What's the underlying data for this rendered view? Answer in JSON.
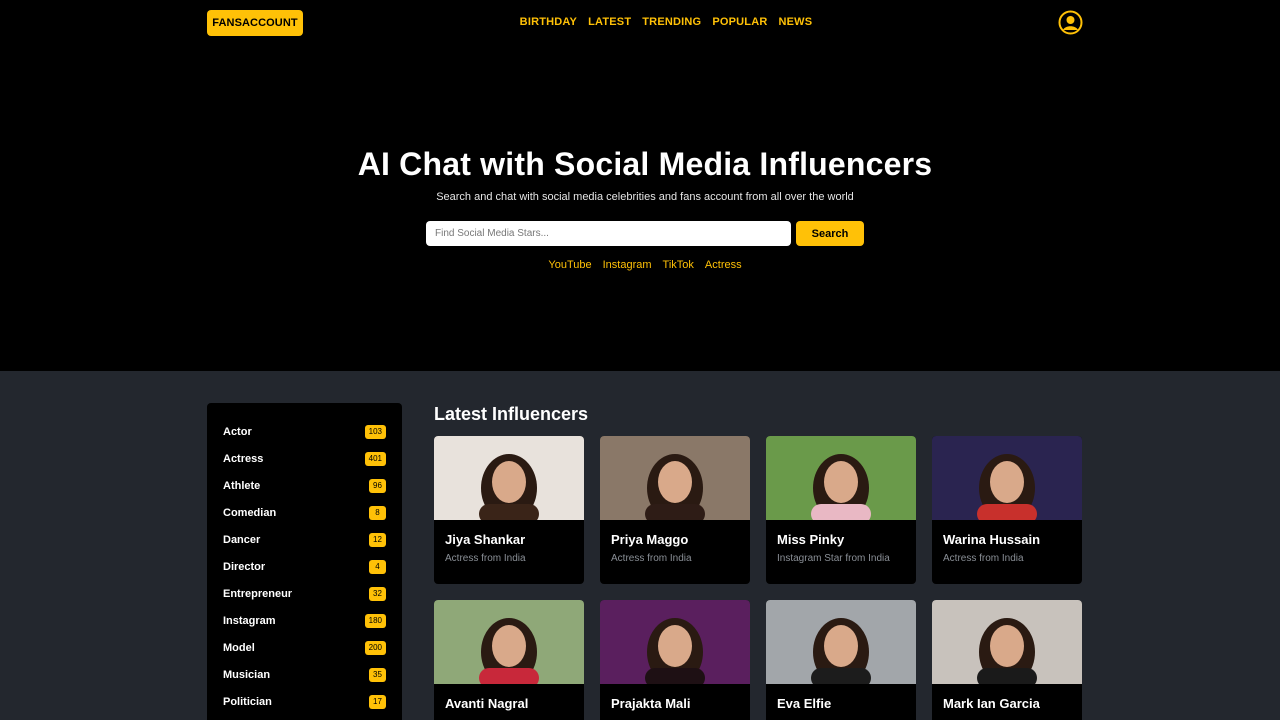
{
  "header": {
    "logo": "FANSACCOUNT",
    "nav": [
      "BIRTHDAY",
      "LATEST",
      "TRENDING",
      "POPULAR",
      "NEWS"
    ]
  },
  "hero": {
    "title": "AI Chat with Social Media Influencers",
    "subtitle": "Search and chat with social media celebrities and fans account from all over the world",
    "search_placeholder": "Find Social Media Stars...",
    "search_button": "Search",
    "quick_links": [
      "YouTube",
      "Instagram",
      "TikTok",
      "Actress"
    ]
  },
  "sidebar": {
    "categories": [
      {
        "label": "Actor",
        "count": "103"
      },
      {
        "label": "Actress",
        "count": "401"
      },
      {
        "label": "Athlete",
        "count": "96"
      },
      {
        "label": "Comedian",
        "count": "8"
      },
      {
        "label": "Dancer",
        "count": "12"
      },
      {
        "label": "Director",
        "count": "4"
      },
      {
        "label": "Entrepreneur",
        "count": "32"
      },
      {
        "label": "Instagram",
        "count": "180"
      },
      {
        "label": "Model",
        "count": "200"
      },
      {
        "label": "Musician",
        "count": "35"
      },
      {
        "label": "Politician",
        "count": "17"
      }
    ]
  },
  "main": {
    "section_title": "Latest Influencers",
    "cards": [
      {
        "name": "Jiya Shankar",
        "desc": "Actress from India",
        "bg": "#e8e2dc",
        "fg": "#3a2418"
      },
      {
        "name": "Priya Maggo",
        "desc": "Actress from India",
        "bg": "#8a7868",
        "fg": "#2e1c16"
      },
      {
        "name": "Miss Pinky",
        "desc": "Instagram Star from India",
        "bg": "#6a9a4a",
        "fg": "#e9b8c4"
      },
      {
        "name": "Warina Hussain",
        "desc": "Actress from India",
        "bg": "#2a2450",
        "fg": "#c8302c"
      },
      {
        "name": "Avanti Nagral",
        "desc": "",
        "bg": "#8fa878",
        "fg": "#c8283a"
      },
      {
        "name": "Prajakta Mali",
        "desc": "",
        "bg": "#5a1f5e",
        "fg": "#1e1014"
      },
      {
        "name": "Eva Elfie",
        "desc": "",
        "bg": "#a2a6aa",
        "fg": "#1c1c1c"
      },
      {
        "name": "Mark Ian Garcia",
        "desc": "",
        "bg": "#c8c2bc",
        "fg": "#1a1a1a"
      }
    ]
  }
}
